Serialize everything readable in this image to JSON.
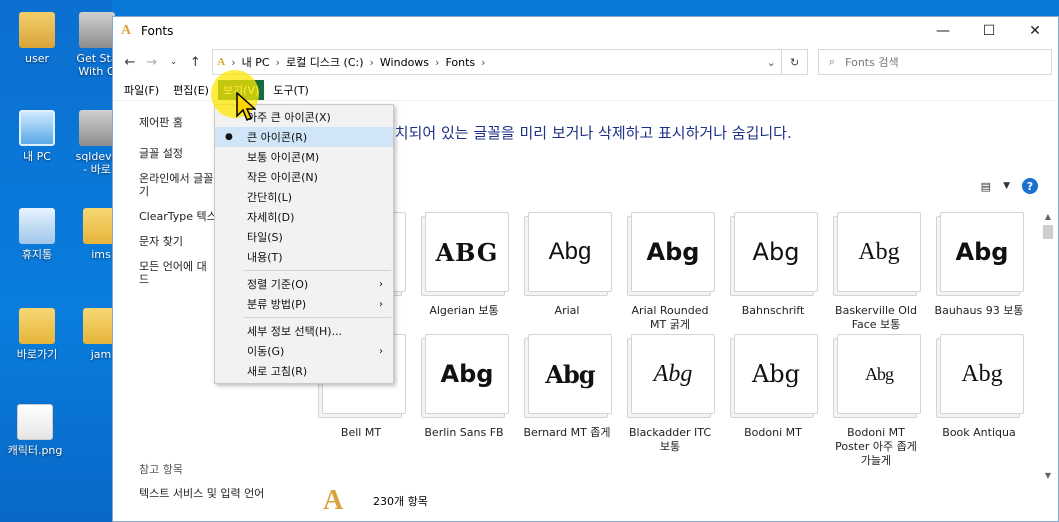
{
  "desktop": {
    "icons": [
      {
        "label": "user",
        "icon": "user-folder-icon"
      },
      {
        "label": "Get Sta\nWith O",
        "icon": "database-icon"
      },
      {
        "label": "내 PC",
        "icon": "pc-icon"
      },
      {
        "label": "sqldeve\n- 바로",
        "icon": "database-icon"
      },
      {
        "label": "휴지통",
        "icon": "recycle-bin-icon"
      },
      {
        "label": "ims",
        "icon": "folder-icon"
      },
      {
        "label": "바로가기",
        "icon": "folder-icon"
      },
      {
        "label": "jam",
        "icon": "folder-icon"
      },
      {
        "label": "캐릭터.png",
        "icon": "image-icon"
      }
    ]
  },
  "window": {
    "title": "Fonts",
    "controls": {
      "minimize": "—",
      "maximize": "☐",
      "close": "✕"
    }
  },
  "address": {
    "crumbs": [
      "내 PC",
      "로컬 디스크 (C:)",
      "Windows",
      "Fonts"
    ],
    "search_placeholder": "Fonts 검색"
  },
  "menubar": {
    "items": [
      "파일(F)",
      "편집(E)",
      "보기(V)",
      "도구(T)"
    ]
  },
  "left_pane": {
    "links": [
      "제어판 홈",
      "글꼴 설정",
      "온라인에서 글꼴\n기",
      "ClearType 텍스",
      "문자 찾기",
      "모든 언어에 대\n드"
    ],
    "see_also_title": "참고 항목",
    "see_also": [
      "텍스트 서비스 및 입력 언어"
    ]
  },
  "heading": "설치되어 있는 글꼴을 미리 보거나 삭제하고 표시하거나 숨깁니다.",
  "view_menu": {
    "items": [
      {
        "label": "아주 큰 아이콘(X)",
        "type": "item"
      },
      {
        "label": "큰 아이콘(R)",
        "type": "item",
        "selected": true
      },
      {
        "label": "보통 아이콘(M)",
        "type": "item"
      },
      {
        "label": "작은 아이콘(N)",
        "type": "item"
      },
      {
        "label": "간단히(L)",
        "type": "item"
      },
      {
        "label": "자세히(D)",
        "type": "item"
      },
      {
        "label": "타일(S)",
        "type": "item"
      },
      {
        "label": "내용(T)",
        "type": "item"
      },
      {
        "label": "정렬 기준(O)",
        "type": "submenu"
      },
      {
        "label": "분류 방법(P)",
        "type": "submenu"
      },
      {
        "label": "세부 정보 선택(H)...",
        "type": "item"
      },
      {
        "label": "이동(G)",
        "type": "submenu"
      },
      {
        "label": "새로 고침(R)",
        "type": "item"
      }
    ]
  },
  "fonts": [
    {
      "name": "Algerian 보통",
      "preview": "ABG"
    },
    {
      "name": "Arial",
      "preview": "Abg"
    },
    {
      "name": "Arial Rounded\nMT 굵게",
      "preview": "Abg"
    },
    {
      "name": "Bahnschrift",
      "preview": "Abg"
    },
    {
      "name": "Baskerville Old\nFace 보통",
      "preview": "Abg"
    },
    {
      "name": "Bauhaus 93 보통",
      "preview": "Abg"
    },
    {
      "name": "Bell MT",
      "preview": ""
    },
    {
      "name": "Berlin Sans FB",
      "preview": "Abg"
    },
    {
      "name": "Bernard MT 좁게",
      "preview": "Abg"
    },
    {
      "name": "Blackadder ITC\n보통",
      "preview": "Abg"
    },
    {
      "name": "Bodoni MT",
      "preview": "Abg"
    },
    {
      "name": "Bodoni MT\nPoster 아주 좁게\n가늘게",
      "preview": "Abg"
    },
    {
      "name": "Book Antiqua",
      "preview": "Abg"
    }
  ],
  "status": {
    "count": "230개 항목"
  },
  "colors": {
    "heading": "#1e3287",
    "menu_active": "#136e3b",
    "selection": "#d0e6f8"
  }
}
